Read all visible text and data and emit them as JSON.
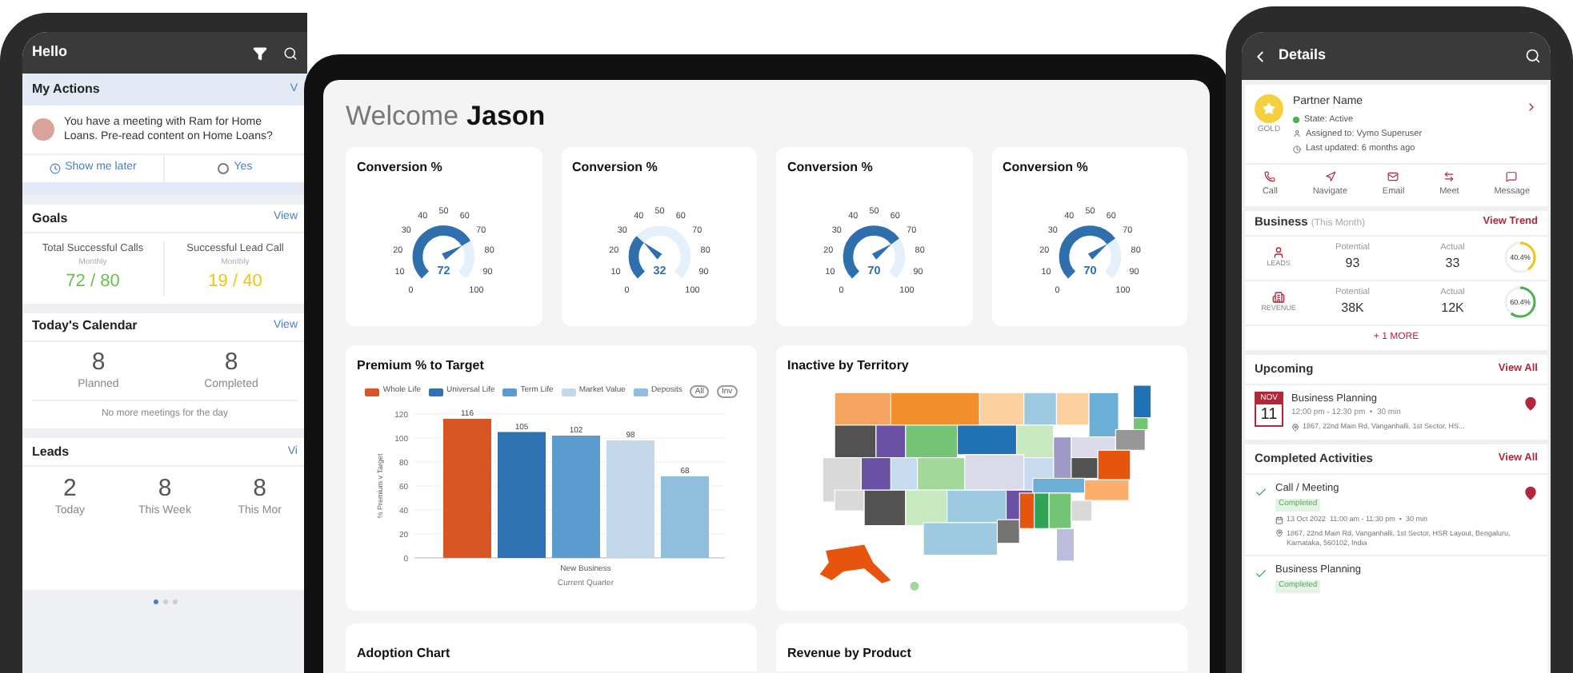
{
  "left_phone": {
    "header": {
      "title": "Hello"
    },
    "my_actions": {
      "title": "My Actions",
      "link": "V",
      "message": "You have a meeting with Ram for Home Loans. Pre-read content on Home Loans?",
      "actions": [
        {
          "kind": "snooze",
          "label": "Show me later"
        },
        {
          "kind": "radio",
          "label": "Yes",
          "checked": false
        }
      ]
    },
    "goals": {
      "title": "Goals",
      "link": "View",
      "items": [
        {
          "label": "Total Successful Calls",
          "period": "Monthly",
          "value": "72 / 80",
          "color": "#6cc04a"
        },
        {
          "label": "Successful Lead Call",
          "period": "Monthly",
          "value": "19 / 40",
          "color": "#f2c511"
        }
      ]
    },
    "calendar": {
      "title": "Today's Calendar",
      "link": "View",
      "stats": [
        {
          "value": "8",
          "label": "Planned"
        },
        {
          "value": "8",
          "label": "Completed"
        }
      ],
      "note": "No more meetings for the day"
    },
    "leads": {
      "title": "Leads",
      "link": "Vi",
      "stats": [
        {
          "value": "2",
          "label": "Today"
        },
        {
          "value": "8",
          "label": "This Week"
        },
        {
          "value": "8",
          "label": "This Mor"
        }
      ]
    },
    "pager": [
      {
        "selected": true
      },
      {
        "selected": false
      },
      {
        "selected": false
      }
    ]
  },
  "tablet": {
    "welcome": {
      "greeting": "Welcome",
      "name": "Jason"
    },
    "gauges": [
      {
        "title": "Conversion %",
        "value": "72",
        "ticks": [
          "0",
          "10",
          "20",
          "30",
          "40",
          "50",
          "60",
          "70",
          "80",
          "90",
          "100"
        ]
      },
      {
        "title": "Conversion %",
        "value": "32",
        "ticks": [
          "0",
          "10",
          "20",
          "30",
          "40",
          "50",
          "60",
          "70",
          "80",
          "90",
          "100"
        ]
      },
      {
        "title": "Conversion %",
        "value": "70",
        "ticks": [
          "0",
          "10",
          "20",
          "30",
          "40",
          "50",
          "60",
          "70",
          "80",
          "90",
          "100"
        ]
      },
      {
        "title": "Conversion %",
        "value": "70",
        "ticks": [
          "0",
          "10",
          "20",
          "30",
          "40",
          "50",
          "60",
          "70",
          "80",
          "90",
          "100"
        ]
      }
    ],
    "premium_chart": {
      "title": "Premium %  to Target",
      "legend_buttons": [
        "All",
        "Inv"
      ],
      "chart_data": {
        "type": "bar",
        "xlabel": "Current Quarter",
        "ylabel": "% Premium v Target",
        "categories": [
          "New Business"
        ],
        "series": [
          {
            "name": "Whole Life",
            "color": "#d95525",
            "values": [
              116
            ]
          },
          {
            "name": "Universal Life",
            "color": "#2f72b3",
            "values": [
              105
            ]
          },
          {
            "name": "Term Life",
            "color": "#5b9bd0",
            "values": [
              102
            ]
          },
          {
            "name": "Market Value",
            "color": "#c4d8ec",
            "values": [
              98
            ]
          },
          {
            "name": "Deposits",
            "color": "#8fbfdd",
            "values": [
              68
            ]
          }
        ],
        "ylim": [
          0,
          120
        ],
        "yticks": [
          0,
          20,
          40,
          60,
          80,
          100,
          120
        ],
        "data_labels": true,
        "grid": true,
        "legend": "top"
      }
    },
    "territory_map": {
      "title": "Inactive by Territory"
    },
    "lower_cards": [
      {
        "title": "Adoption Chart"
      },
      {
        "title": "Revenue by Product"
      }
    ]
  },
  "right_phone": {
    "header": {
      "title": "Details"
    },
    "partner": {
      "tier": "GOLD",
      "name": "Partner Name",
      "state": "State: Active",
      "assigned": "Assigned to: Vymo Superuser",
      "updated": "Last updated: 6 months ago"
    },
    "actions": [
      {
        "kind": "call",
        "label": "Call"
      },
      {
        "kind": "navigate",
        "label": "Navigate"
      },
      {
        "kind": "email",
        "label": "Email"
      },
      {
        "kind": "meet",
        "label": "Meet"
      },
      {
        "kind": "message",
        "label": "Message"
      }
    ],
    "business": {
      "title": "Business",
      "period": "(This Month)",
      "link": "View Trend",
      "rows": [
        {
          "kind": "leads",
          "label": "LEADS",
          "potential_label": "Potential",
          "potential": "93",
          "actual_label": "Actual",
          "actual": "33",
          "reading": "40.4%",
          "color": "#f2c511"
        },
        {
          "kind": "revenue",
          "label": "REVENUE",
          "potential_label": "Potential",
          "potential": "38K",
          "actual_label": "Actual",
          "actual": "12K",
          "reading": "60.4%",
          "color": "#4caf50"
        }
      ],
      "more": "+ 1 MORE"
    },
    "upcoming": {
      "title": "Upcoming",
      "link": "View All",
      "event": {
        "month": "NOV",
        "day": "11",
        "title": "Business Planning",
        "time": "12:00 pm - 12:30 pm  •  30 min",
        "address": "1867, 22nd Main Rd, Vanganhalli, 1st Sector, HS..."
      }
    },
    "completed": {
      "title": "Completed Activities",
      "link": "View All",
      "items": [
        {
          "title": "Call / Meeting",
          "status": "Completed",
          "date": "13 Oct 2022  11:00 am - 11:30 pm  •  30 min",
          "address": "1867, 22nd Main Rd, Vanganhalli, 1st Sector, HSR Layout, Bengaluru, Karnataka, 560102, India"
        },
        {
          "title": "Business Planning",
          "status": "Completed"
        }
      ]
    }
  }
}
